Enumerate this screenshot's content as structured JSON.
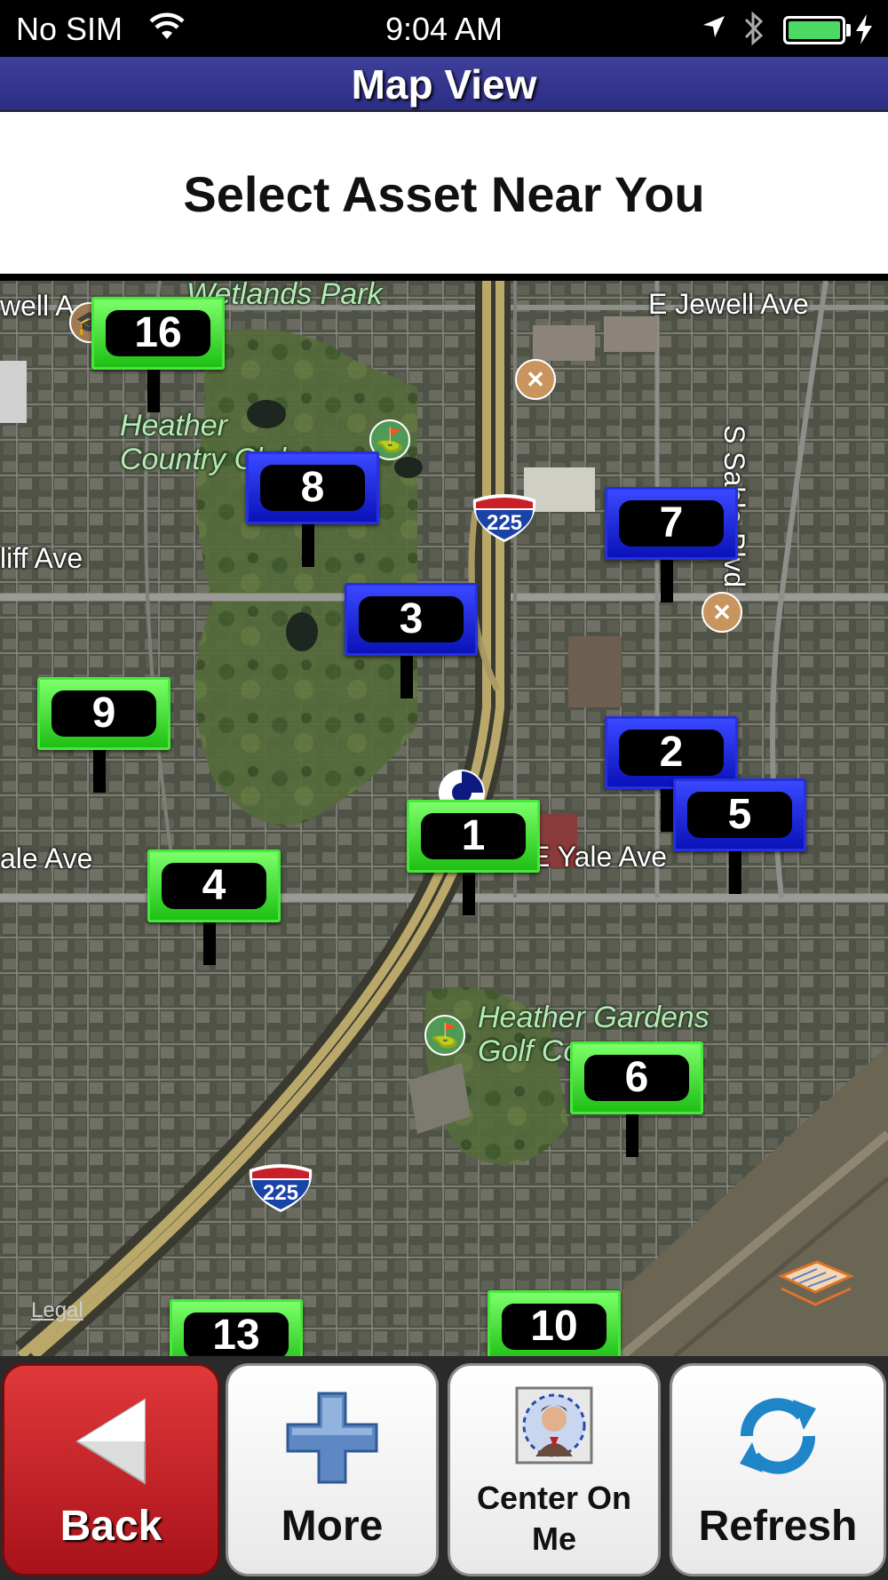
{
  "status_bar": {
    "carrier": "No SIM",
    "time": "9:04 AM",
    "battery_color": "#4cd964",
    "icons": [
      "wifi-icon",
      "location-arrow-icon",
      "bluetooth-icon",
      "battery-icon",
      "charging-bolt-icon"
    ]
  },
  "header": {
    "title": "Map View",
    "background": "#2c2d85"
  },
  "subtitle": "Select Asset Near You",
  "map": {
    "streets": {
      "jewell_left": "well A",
      "jewell_right": "E Jewell Ave",
      "iliff": "liff Ave",
      "yale_left": "ale Ave",
      "yale_right": "E Yale Ave",
      "sable": "S Sable Blvd"
    },
    "parks": {
      "wetlands": "Wetlands Park",
      "heather_country_1": "Heather",
      "heather_country_2": "Country Club",
      "heather_gardens_1": "Heather Gardens",
      "heather_gardens_2": "Golf Course"
    },
    "highway_shield": "225",
    "legal": "Legal",
    "assets": [
      {
        "number": "16",
        "color": "green"
      },
      {
        "number": "8",
        "color": "blue"
      },
      {
        "number": "7",
        "color": "blue"
      },
      {
        "number": "3",
        "color": "blue"
      },
      {
        "number": "9",
        "color": "green"
      },
      {
        "number": "2",
        "color": "blue"
      },
      {
        "number": "5",
        "color": "blue"
      },
      {
        "number": "1",
        "color": "green"
      },
      {
        "number": "4",
        "color": "green"
      },
      {
        "number": "6",
        "color": "green"
      },
      {
        "number": "13",
        "color": "green"
      },
      {
        "number": "10",
        "color": "green"
      }
    ],
    "marker_colors": {
      "green": "#1fbf15",
      "blue": "#0a12b8"
    }
  },
  "toolbar": {
    "back_label": "Back",
    "more_label": "More",
    "center_label_1": "Center On",
    "center_label_2": "Me",
    "refresh_label": "Refresh"
  }
}
